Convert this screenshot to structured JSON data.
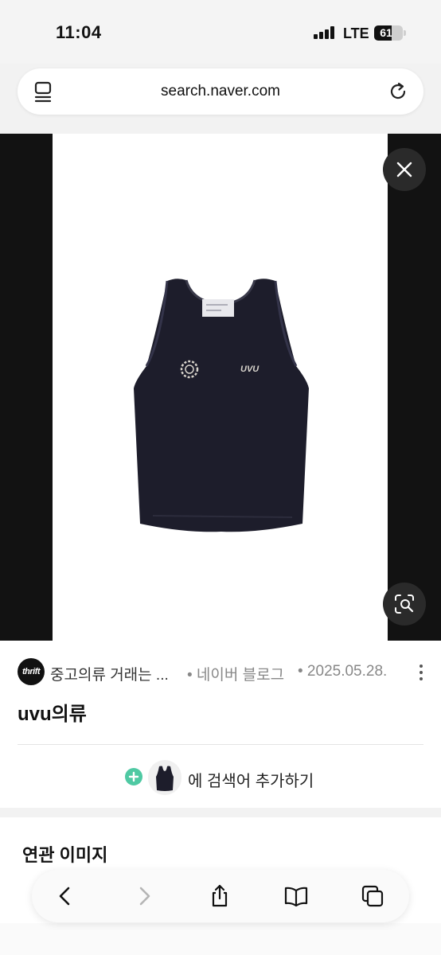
{
  "status_bar": {
    "time": "11:04",
    "network": "LTE",
    "battery_percent": 61,
    "battery_label": "61"
  },
  "browser": {
    "url": "search.naver.com",
    "icons": [
      "tabs-icon",
      "reload-icon"
    ]
  },
  "viewer": {
    "image_subject": "tank-top",
    "buttons": [
      "close-icon",
      "lens-search-icon"
    ]
  },
  "result": {
    "source_logo_text": "thrift",
    "source_title": "중고의류 거래는 ...",
    "source_name": "• 네이버 블로그",
    "source_date": "• 2025.05.28.",
    "image_title": "uvu의류",
    "add_search_label": "에 검색어 추가하기"
  },
  "related": {
    "title": "연관 이미지"
  },
  "toolbar": {
    "buttons": [
      "back-icon",
      "forward-icon",
      "share-icon",
      "bookmarks-icon",
      "tabs-overview-icon"
    ]
  },
  "colors": {
    "accent_green": "#4fc9a3",
    "viewer_background": "#121212"
  }
}
